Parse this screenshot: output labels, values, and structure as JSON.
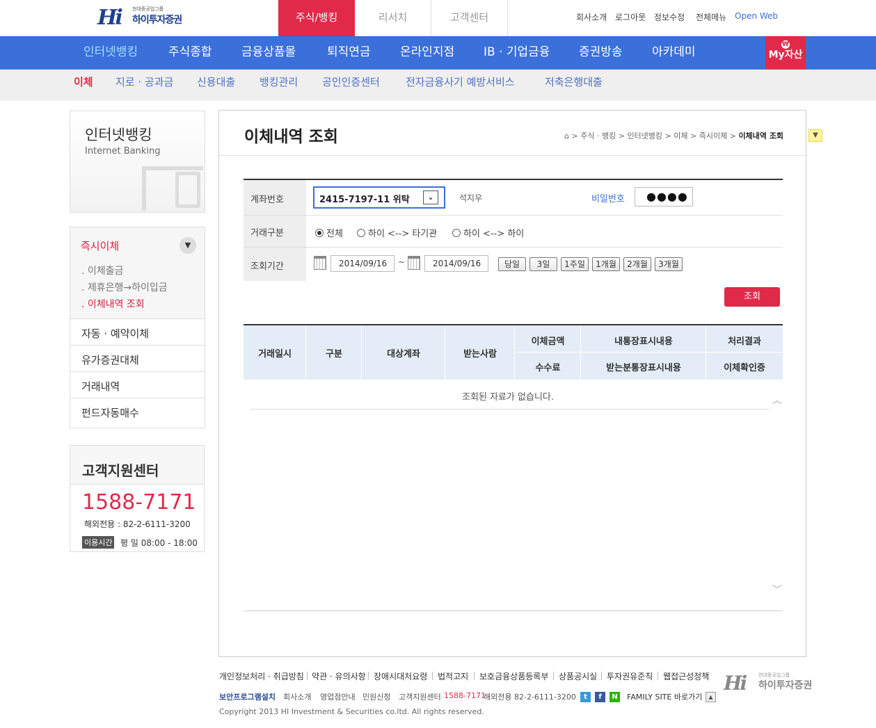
{
  "header": {
    "logo_small": "현대중공업그룹",
    "logo_name": "하이투자증권",
    "logo_mark": "Hi",
    "tabs": [
      "주식/뱅킹",
      "리서치",
      "고객센터"
    ],
    "util_links": [
      "회사소개",
      "로그아웃",
      "정보수정",
      "전체메뉴",
      "Open Web"
    ]
  },
  "nav": {
    "items": [
      "인터넷뱅킹",
      "주식종합",
      "금융상품몰",
      "퇴직연금",
      "온라인지점",
      "IB · 기업금융",
      "증권방송",
      "아카데미"
    ],
    "my_asset_icon": "₩",
    "my_asset": "My자산"
  },
  "subnav": {
    "items": [
      "이체",
      "지로 · 공과금",
      "신용대출",
      "뱅킹관리",
      "공인인증센터",
      "전자금융사기 예방서비스",
      "저축은행대출"
    ]
  },
  "sidebar": {
    "title": "인터넷뱅킹",
    "subtitle": "Internet Banking",
    "active_group": "즉시이체",
    "toggle": "▼",
    "sub_items": [
      ". 이체출금",
      ". 제휴은행→하이입금",
      ". 이체내역 조회"
    ],
    "groups": [
      "자동 · 예약이체",
      "유가증권대체",
      "거래내역",
      "펀드자동매수"
    ]
  },
  "support": {
    "title": "고객지원센터",
    "phone": "1588-7171",
    "overseas": "해외전용 : 82-2-6111-3200",
    "hours_badge": "이용시간",
    "hours": "평     일 08:00 - 18:00"
  },
  "main": {
    "title": "이체내역 조회",
    "breadcrumb": [
      "주식 · 뱅킹",
      "인터넷뱅킹",
      "이체",
      "즉시이체"
    ],
    "breadcrumb_current": "이체내역 조회",
    "breadcrumb_sep": ">",
    "scroll_btn": "▼"
  },
  "form": {
    "account_label": "계좌번호",
    "account_value": "2415-7197-11   위탁",
    "account_dropdown": "⌄",
    "owner": "석지우",
    "password_label": "비밀번호",
    "password_mask": "●●●●",
    "type_label": "거래구분",
    "types": [
      "전체",
      "하이 <--> 타기관",
      "하이 <--> 하이"
    ],
    "selected_type": "전체",
    "period_label": "조회기간",
    "date_from": "2014/09/16",
    "date_to": "2014/09/16",
    "date_sep": "~",
    "period_buttons": [
      "당일",
      "3일",
      "1주일",
      "1개월",
      "2개월",
      "3개월"
    ],
    "search_button": "조회"
  },
  "table": {
    "headers": [
      "거래일시",
      "구분",
      "대상계좌",
      "받는사람"
    ],
    "headers_top": [
      "이체금액",
      "내통장표시내용",
      "처리결과"
    ],
    "headers_bottom": [
      "수수료",
      "받는분통장표시내용",
      "이체확인증"
    ],
    "empty_message": "조회된 자료가 없습니다.",
    "scroll_up": "︿",
    "scroll_down": "﹀"
  },
  "footer": {
    "links": [
      "개인정보처리 · 취급방침",
      "약관 · 유의사항",
      "장애시대처요령",
      "법적고지",
      "보호금융상품등록부",
      "상품공시실",
      "투자권유준칙",
      "웹접근성정책"
    ],
    "line2": [
      "보안프로그램설치",
      "회사소개",
      "영업점안내",
      "민원신청",
      "고객지원센터",
      "1588-7171",
      "해외전용 82-2-6111-3200"
    ],
    "social": [
      "t",
      "f",
      "N"
    ],
    "family_site": "FAMILY SITE 바로가기",
    "family_toggle": "▲",
    "copyright": "Copyright 2013 HI Investment & Securities co.ltd. All rights reserved.",
    "logo_small": "현대중공업그룹",
    "logo_name": "하이투자증권",
    "logo_mark": "Hi"
  },
  "colors": {
    "accent_red": "#e1294a",
    "nav_blue": "#3b6fd9",
    "twitter": "#3a9ad9",
    "facebook": "#3b5998",
    "naver": "#2db400"
  }
}
